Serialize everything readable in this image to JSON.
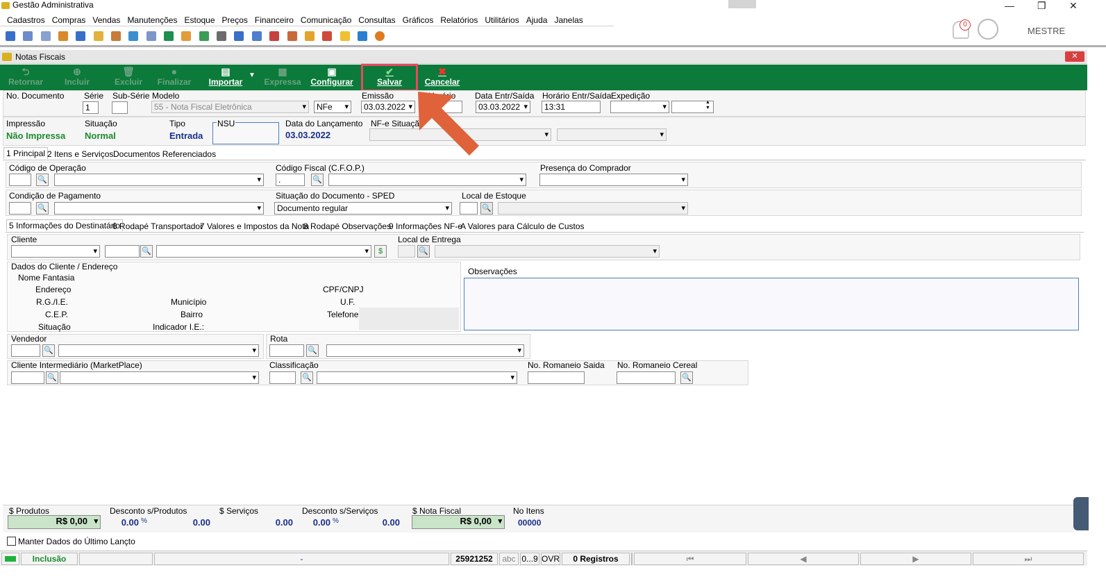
{
  "app": {
    "title": "Gestão Administrativa"
  },
  "menu": [
    "Cadastros",
    "Compras",
    "Vendas",
    "Manutenções",
    "Estoque",
    "Preços",
    "Financeiro",
    "Comunicação",
    "Consultas",
    "Gráficos",
    "Relatórios",
    "Utilitários",
    "Ajuda",
    "Janelas"
  ],
  "user": {
    "name": "MESTRE",
    "notifications": "0"
  },
  "window": {
    "title": "Notas Fiscais"
  },
  "toolbar": {
    "retornar": "Retornar",
    "incluir": "Incluir",
    "excluir": "Excluir",
    "finalizar": "Finalizar",
    "importar": "Importar",
    "expressa": "Expressa",
    "configurar": "Configurar",
    "salvar": "Salvar",
    "cancelar": "Cancelar"
  },
  "header": {
    "no_documento_label": "No. Documento",
    "serie_label": "Série",
    "serie_value": "1",
    "subserie_label": "Sub-Série",
    "modelo_label": "Modelo",
    "modelo_value": "55 - Nota Fiscal Eletrônica",
    "modelo_type": "NFe",
    "emissao_label": "Emissão",
    "emissao_value": "03.03.2022",
    "horario_label": "Horário",
    "data_entr_label": "Data Entr/Saída",
    "data_entr_value": "03.03.2022",
    "horario_entr_label": "Horário Entr/Saída",
    "horario_entr_value": "13:31",
    "expedicao_label": "Expedição"
  },
  "status_row": {
    "impressao_label": "Impressão",
    "impressao_value": "Não Impressa",
    "situacao_label": "Situação",
    "situacao_value": "Normal",
    "tipo_label": "Tipo",
    "tipo_value": "Entrada",
    "nsu_label": "NSU",
    "data_lancamento_label": "Data do Lançamento",
    "data_lancamento_value": "03.03.2022",
    "nfe_situacao_label": "NF-e Situação"
  },
  "tabs_main": [
    "1 Principal",
    "2 Itens e Serviços",
    "Documentos Referenciados"
  ],
  "principal": {
    "codigo_operacao": "Código de Operação",
    "codigo_fiscal": "Código Fiscal (C.F.O.P.)",
    "codigo_fiscal_value": ".",
    "presenca": "Presença do Comprador",
    "condicao": "Condição de Pagamento",
    "situacao_doc": "Situação do Documento - SPED",
    "situacao_doc_value": "Documento regular",
    "local_estoque": "Local de Estoque"
  },
  "tabs_sub": [
    "5 Informações do Destinatário",
    "6 Rodapé Transportador",
    "7 Valores e Impostos da Nota",
    "8 Rodapé Observações",
    "9 Informações NF-e",
    "A Valores para Cálculo de Custos"
  ],
  "destinatario": {
    "cliente": "Cliente",
    "local_entrega": "Local de Entrega",
    "dados_title": "Dados do Cliente / Endereço",
    "nome_fantasia": "Nome Fantasia",
    "endereco": "Endereço",
    "rg_ie": "R.G./I.E.",
    "cep": "C.E.P.",
    "situacao": "Situação",
    "municipio": "Município",
    "bairro": "Bairro",
    "indicador_ie": "Indicador I.E.:",
    "cpf_cnpj": "CPF/CNPJ",
    "uf": "U.F.",
    "telefone": "Telefone",
    "observacoes": "Observações",
    "vendedor": "Vendedor",
    "rota": "Rota",
    "cliente_intermediario": "Cliente Intermediário (MarketPlace)",
    "classificacao": "Classificação",
    "romaneio_saida": "No. Romaneio Saida",
    "romaneio_cereal": "No. Romaneio Cereal"
  },
  "totals": {
    "produtos_label": "$ Produtos",
    "produtos_value": "R$ 0,00",
    "desc_produtos_label": "Desconto s/Produtos",
    "desc_produtos_pct": "0.00",
    "desc_produtos_value": "0.00",
    "servicos_label": "$ Serviços",
    "servicos_value": "0.00",
    "desc_servicos_label": "Desconto s/Serviços",
    "desc_servicos_pct": "0.00",
    "desc_servicos_value": "0.00",
    "nota_label": "$ Nota Fiscal",
    "nota_value": "R$ 0,00",
    "itens_label": "No Itens",
    "itens_value": "00000",
    "pct_symbol": "%"
  },
  "manter": "Manter Dados do Último Lançto",
  "statusbar": {
    "mode": "Inclusão",
    "dash": "-",
    "code": "25921252",
    "abc": "abc",
    "digits": "0...9",
    "ovr": "OVR",
    "registros": "0 Registros"
  },
  "colors": {
    "accent": "#0b7a3a",
    "highlight": "#e8495f",
    "arrow": "#e0623a"
  }
}
